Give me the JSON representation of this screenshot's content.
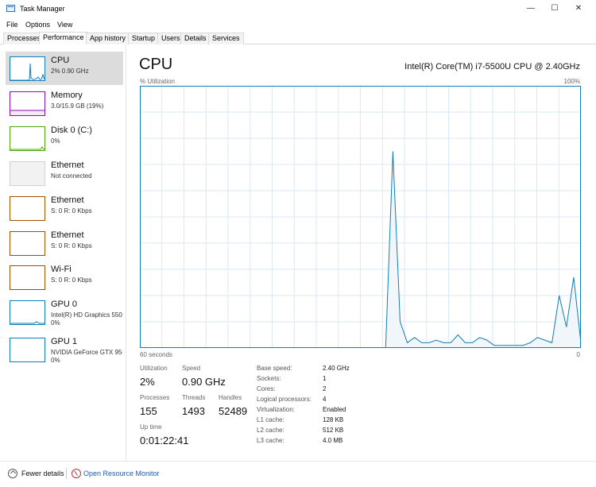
{
  "window": {
    "title": "Task Manager",
    "controls": {
      "minimize": "—",
      "maximize": "☐",
      "close": "✕"
    }
  },
  "menu": [
    "File",
    "Options",
    "View"
  ],
  "tabs": [
    "Processes",
    "Performance",
    "App history",
    "Startup",
    "Users",
    "Details",
    "Services"
  ],
  "active_tab": "Performance",
  "sidebar": {
    "items": [
      {
        "title": "CPU",
        "sub": "2%  0.90 GHz",
        "sub2": "",
        "color": "#117dbb",
        "selected": true
      },
      {
        "title": "Memory",
        "sub": "3.0/15.9 GB (19%)",
        "sub2": "",
        "color": "#8b12ae",
        "selected": false
      },
      {
        "title": "Disk 0 (C:)",
        "sub": "0%",
        "sub2": "",
        "color": "#4da60c",
        "selected": false
      },
      {
        "title": "Ethernet",
        "sub": "Not connected",
        "sub2": "",
        "color": "#c8c8c8",
        "selected": false
      },
      {
        "title": "Ethernet",
        "sub": "S: 0  R: 0 Kbps",
        "sub2": "",
        "color": "#a74f01",
        "selected": false
      },
      {
        "title": "Ethernet",
        "sub": "S: 0  R: 0 Kbps",
        "sub2": "",
        "color": "#a74f01",
        "selected": false
      },
      {
        "title": "Wi-Fi",
        "sub": "S: 0  R: 0 Kbps",
        "sub2": "",
        "color": "#a74f01",
        "selected": false
      },
      {
        "title": "GPU 0",
        "sub": "Intel(R) HD Graphics 5500",
        "sub2": "0%",
        "color": "#117dbb",
        "selected": false
      },
      {
        "title": "GPU 1",
        "sub": "NVIDIA GeForce GTX 950M",
        "sub2": "0%",
        "color": "#117dbb",
        "selected": false
      }
    ]
  },
  "main": {
    "title": "CPU",
    "cpu_model": "Intel(R) Core(TM) i7-5500U CPU @ 2.40GHz",
    "y_label": "% Utilization",
    "y_max_label": "100%",
    "x_left_label": "60 seconds",
    "x_right_label": "0"
  },
  "chart_data": {
    "type": "area",
    "x": [
      0,
      1,
      2,
      3,
      4,
      5,
      6,
      7,
      8,
      9,
      10,
      11,
      12,
      13,
      14,
      15,
      16,
      17,
      18,
      19,
      20,
      21,
      22,
      23,
      24,
      25,
      26,
      27,
      28,
      29,
      30,
      31,
      32,
      33,
      34,
      35,
      36,
      37,
      38,
      39,
      40,
      41,
      42,
      43,
      44,
      45,
      46,
      47,
      48,
      49,
      50,
      51,
      52,
      53,
      54,
      55,
      56,
      57,
      58,
      59,
      60
    ],
    "values": [
      0,
      0,
      0,
      0,
      0,
      0,
      0,
      0,
      0,
      0,
      0,
      0,
      0,
      0,
      0,
      0,
      0,
      0,
      0,
      0,
      0,
      0,
      0,
      0,
      0,
      0,
      0,
      0,
      0,
      0,
      0,
      0,
      0,
      0,
      0,
      75,
      10,
      2,
      4,
      2,
      2,
      3,
      2,
      2,
      5,
      2,
      2,
      4,
      3,
      1,
      1,
      1,
      1,
      1,
      2,
      4,
      3,
      2,
      20,
      8,
      27,
      2
    ],
    "ylim": [
      0,
      100
    ],
    "xlim": [
      0,
      60
    ],
    "grid": true,
    "line_color": "#117dbb",
    "fill_color": "#f1f6fa",
    "grid_color": "#d9eaf4"
  },
  "stats": {
    "utilization_label": "Utilization",
    "utilization": "2%",
    "speed_label": "Speed",
    "speed": "0.90 GHz",
    "processes_label": "Processes",
    "processes": "155",
    "threads_label": "Threads",
    "threads": "1493",
    "handles_label": "Handles",
    "handles": "52489",
    "uptime_label": "Up time",
    "uptime": "0:01:22:41"
  },
  "details": [
    {
      "label": "Base speed:",
      "value": "2.40 GHz"
    },
    {
      "label": "Sockets:",
      "value": "1"
    },
    {
      "label": "Cores:",
      "value": "2"
    },
    {
      "label": "Logical processors:",
      "value": "4"
    },
    {
      "label": "Virtualization:",
      "value": "Enabled"
    },
    {
      "label": "L1 cache:",
      "value": "128 KB"
    },
    {
      "label": "L2 cache:",
      "value": "512 KB"
    },
    {
      "label": "L3 cache:",
      "value": "4.0 MB"
    }
  ],
  "footer": {
    "fewer_details": "Fewer details",
    "resource_monitor": "Open Resource Monitor"
  }
}
